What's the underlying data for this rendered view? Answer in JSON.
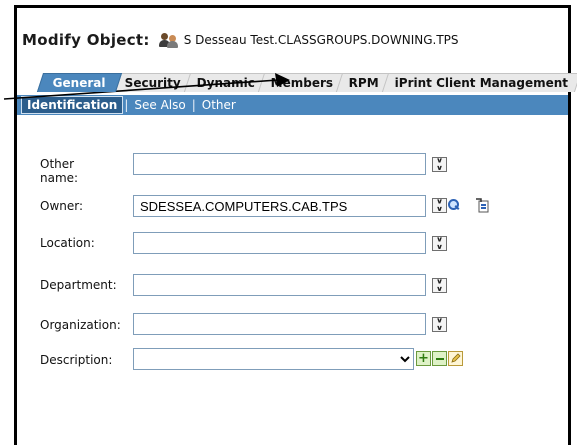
{
  "header": {
    "title": "Modify Object:",
    "object_icon": "group-users-icon",
    "object_name": "S Desseau Test.CLASSGROUPS.DOWNING.TPS"
  },
  "tabs": [
    {
      "label": "General",
      "active": true
    },
    {
      "label": "Security",
      "active": false
    },
    {
      "label": "Dynamic",
      "active": false
    },
    {
      "label": "Members",
      "active": false
    },
    {
      "label": "RPM",
      "active": false
    },
    {
      "label": "iPrint Client Management",
      "active": false
    }
  ],
  "subtabs": [
    {
      "label": "Identification",
      "active": true
    },
    {
      "label": "See Also",
      "active": false
    },
    {
      "label": "Other",
      "active": false
    }
  ],
  "subtab_separator": "|",
  "form": {
    "other_name": {
      "label": "Other name:",
      "value": ""
    },
    "owner": {
      "label": "Owner:",
      "value": "SDESSEA.COMPUTERS.CAB.TPS"
    },
    "location": {
      "label": "Location:",
      "value": ""
    },
    "department": {
      "label": "Department:",
      "value": ""
    },
    "organization": {
      "label": "Organization:",
      "value": ""
    },
    "description": {
      "label": "Description:",
      "value": ""
    }
  },
  "colors": {
    "accent_blue": "#4b87bd",
    "active_subtab": "#2b5d8c",
    "frame": "#000000"
  }
}
